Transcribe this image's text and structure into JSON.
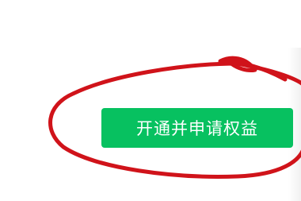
{
  "button": {
    "label": "开通并申请权益"
  },
  "colors": {
    "button_background": "#07c160",
    "annotation_stroke": "#d0131a"
  }
}
